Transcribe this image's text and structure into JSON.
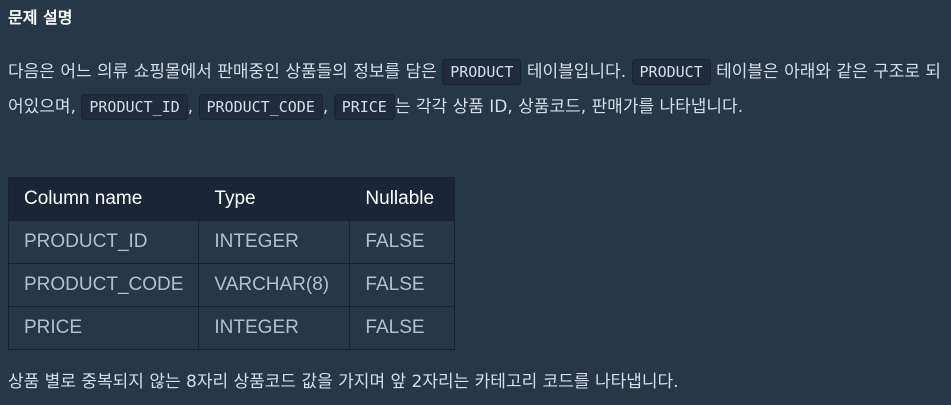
{
  "heading": "문제 설명",
  "paragraph": {
    "t1": "다음은 어느 의류 쇼핑몰에서 판매중인 상품들의 정보를 담은 ",
    "c1": "PRODUCT",
    "t2": " 테이블입니다. ",
    "c2": "PRODUCT",
    "t3": " 테이블은 아래와 같은 구조로 되어있으며, ",
    "c3": "PRODUCT_ID",
    "t4": ", ",
    "c4": "PRODUCT_CODE",
    "t5": ", ",
    "c5": "PRICE",
    "t6": "는 각각 상품 ID, 상품코드, 판매가를 나타냅니다."
  },
  "table": {
    "headers": [
      "Column name",
      "Type",
      "Nullable"
    ],
    "rows": [
      [
        "PRODUCT_ID",
        "INTEGER",
        "FALSE"
      ],
      [
        "PRODUCT_CODE",
        "VARCHAR(8)",
        "FALSE"
      ],
      [
        "PRICE",
        "INTEGER",
        "FALSE"
      ]
    ]
  },
  "footer": "상품 별로 중복되지 않는 8자리 상품코드 값을 가지며 앞 2자리는 카테고리 코드를 나타냅니다."
}
